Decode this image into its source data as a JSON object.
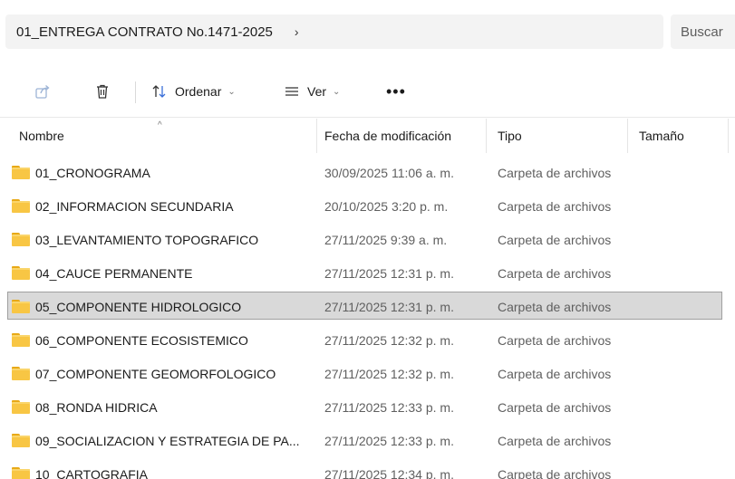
{
  "address_bar": {
    "path": "01_ENTREGA CONTRATO No.1471-2025",
    "chevron": "›",
    "search_placeholder": "Buscar"
  },
  "toolbar": {
    "share_icon": "share-icon",
    "delete_icon": "trash-icon",
    "sort_label": "Ordenar",
    "view_label": "Ver",
    "more_label": "•••",
    "chevron": "⌄"
  },
  "columns": {
    "name": "Nombre",
    "date": "Fecha de modificación",
    "type": "Tipo",
    "size": "Tamaño"
  },
  "files": [
    {
      "name": "01_CRONOGRAMA",
      "date": "30/09/2025 11:06 a. m.",
      "type": "Carpeta de archivos"
    },
    {
      "name": "02_INFORMACION SECUNDARIA",
      "date": "20/10/2025 3:20 p. m.",
      "type": "Carpeta de archivos"
    },
    {
      "name": "03_LEVANTAMIENTO TOPOGRAFICO",
      "date": "27/11/2025 9:39 a. m.",
      "type": "Carpeta de archivos"
    },
    {
      "name": "04_CAUCE PERMANENTE",
      "date": "27/11/2025 12:31 p. m.",
      "type": "Carpeta de archivos"
    },
    {
      "name": "05_COMPONENTE HIDROLOGICO",
      "date": "27/11/2025 12:31 p. m.",
      "type": "Carpeta de archivos",
      "selected": true
    },
    {
      "name": "06_COMPONENTE ECOSISTEMICO",
      "date": "27/11/2025 12:32 p. m.",
      "type": "Carpeta de archivos"
    },
    {
      "name": "07_COMPONENTE GEOMORFOLOGICO",
      "date": "27/11/2025 12:32 p. m.",
      "type": "Carpeta de archivos"
    },
    {
      "name": "08_RONDA HIDRICA",
      "date": "27/11/2025 12:33 p. m.",
      "type": "Carpeta de archivos"
    },
    {
      "name": "09_SOCIALIZACION Y ESTRATEGIA DE PA...",
      "date": "27/11/2025 12:33 p. m.",
      "type": "Carpeta de archivos"
    },
    {
      "name": "10_CARTOGRAFIA",
      "date": "27/11/2025 12:34 p. m.",
      "type": "Carpeta de archivos"
    }
  ],
  "colors": {
    "selected_bg": "#d9d9d9",
    "folder": "#f8c644"
  }
}
